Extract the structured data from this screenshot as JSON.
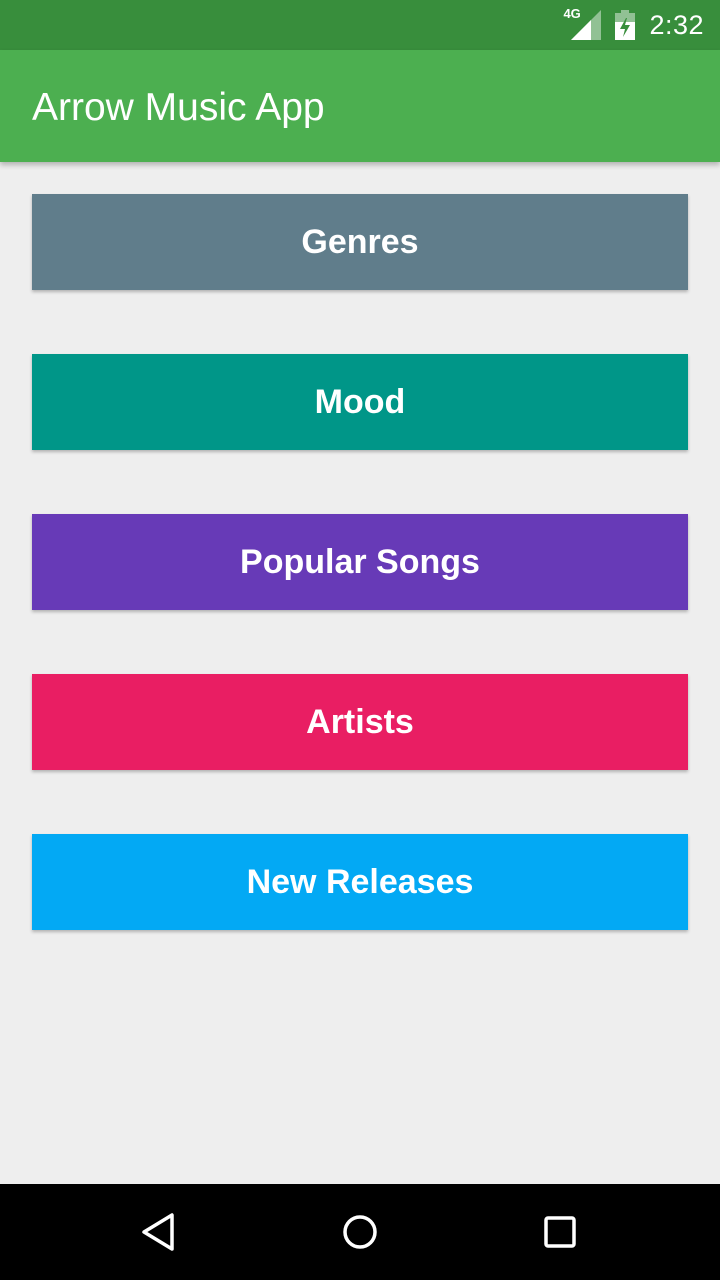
{
  "status_bar": {
    "network": "4G",
    "time": "2:32"
  },
  "app_bar": {
    "title": "Arrow Music App"
  },
  "menu": [
    {
      "label": "Genres",
      "color": "#607d8b"
    },
    {
      "label": "Mood",
      "color": "#009688"
    },
    {
      "label": "Popular Songs",
      "color": "#673ab7"
    },
    {
      "label": "Artists",
      "color": "#e91e63"
    },
    {
      "label": "New Releases",
      "color": "#03a9f4"
    }
  ],
  "theme": {
    "status_bar": "#388e3c",
    "app_bar": "#4caf50",
    "background": "#eeeeee"
  },
  "nav_bar": {
    "icons": [
      "back-icon",
      "home-icon",
      "recents-icon"
    ]
  }
}
